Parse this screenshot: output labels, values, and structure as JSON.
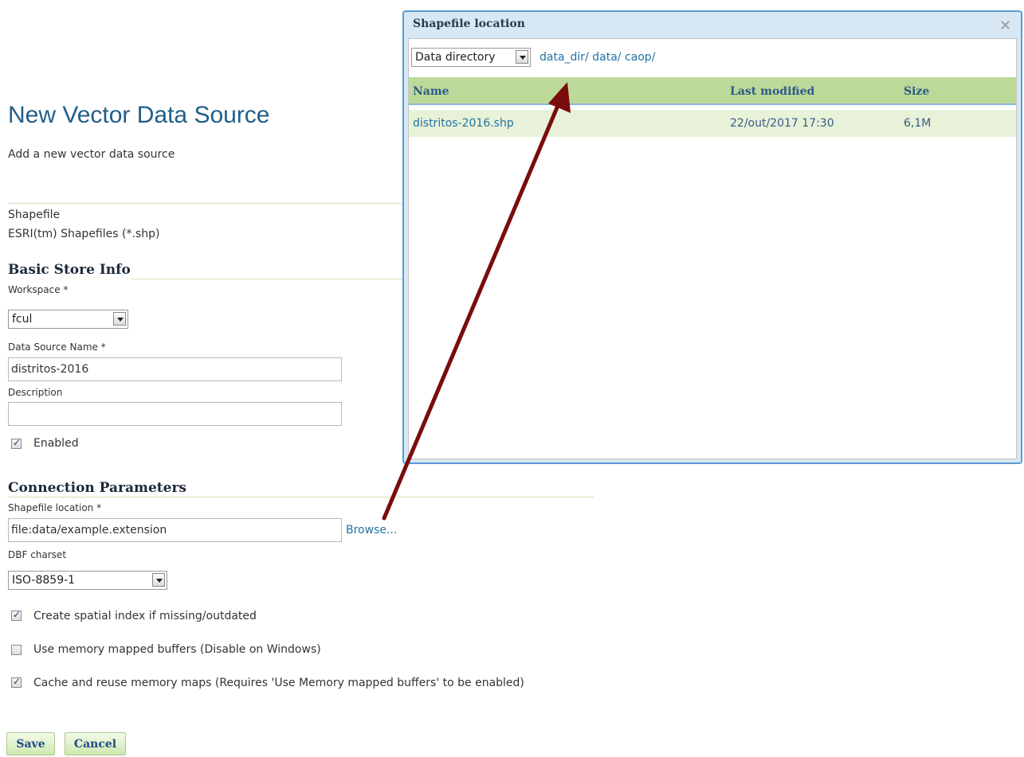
{
  "page": {
    "title": "New Vector Data Source",
    "subtitle": "Add a new vector data source",
    "source_type": "Shapefile",
    "source_desc": "ESRI(tm) Shapefiles (*.shp)"
  },
  "basic": {
    "heading": "Basic Store Info",
    "workspace_label": "Workspace *",
    "workspace_value": "fcul",
    "name_label": "Data Source Name *",
    "name_value": "distritos-2016",
    "desc_label": "Description",
    "desc_value": "",
    "enabled_label": "Enabled",
    "enabled_checked": true
  },
  "connection": {
    "heading": "Connection Parameters",
    "location_label": "Shapefile location *",
    "location_value": "file:data/example.extension",
    "browse_label": "Browse...",
    "charset_label": "DBF charset",
    "charset_value": "ISO-8859-1",
    "options": [
      {
        "label": "Create spatial index if missing/outdated",
        "checked": true
      },
      {
        "label": "Use memory mapped buffers (Disable on Windows)",
        "checked": false
      },
      {
        "label": "Cache and reuse memory maps (Requires 'Use Memory mapped buffers' to be enabled)",
        "checked": true
      }
    ]
  },
  "buttons": {
    "save": "Save",
    "cancel": "Cancel"
  },
  "dialog": {
    "title": "Shapefile location",
    "close_icon": "close-icon",
    "root_select": "Data directory",
    "breadcrumb": [
      "data_dir/",
      "data/",
      "caop/"
    ],
    "columns": [
      "Name",
      "Last modified",
      "Size"
    ],
    "rows": [
      {
        "name": "distritos-2016.shp",
        "modified": "22/out/2017 17:30",
        "size": "6,1M"
      }
    ]
  },
  "colors": {
    "title": "#1f5e8a",
    "link": "#2472a4",
    "header_bg": "#bcd99a",
    "row_bg": "#e8f2d8",
    "arrow": "#7a0c0c",
    "dialog_border": "#5b9bd5"
  }
}
